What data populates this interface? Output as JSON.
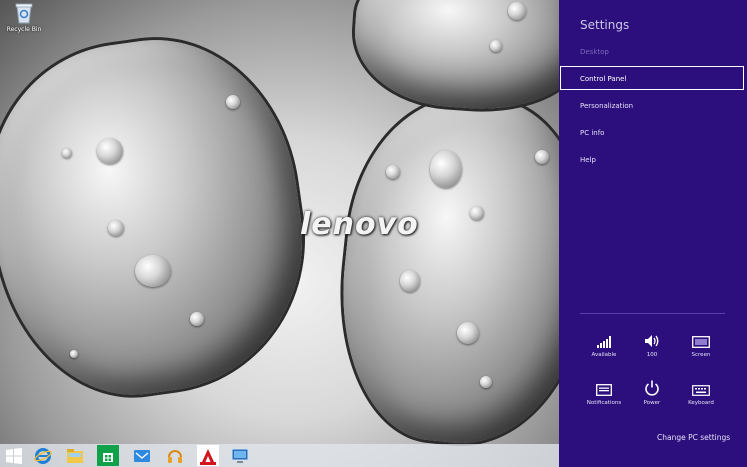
{
  "desktop": {
    "recycle_bin_label": "Recycle Bin",
    "brand_logo": "lenovo"
  },
  "taskbar": {
    "icons": [
      "start-icon",
      "internet-explorer-icon",
      "file-explorer-icon",
      "store-icon",
      "mail-icon",
      "media-icon",
      "adobe-icon",
      "remote-desktop-icon"
    ]
  },
  "settings_charm": {
    "title": "Settings",
    "items": [
      {
        "label": "Desktop",
        "state": "disabled"
      },
      {
        "label": "Control Panel",
        "state": "selected"
      },
      {
        "label": "Personalization",
        "state": "normal"
      },
      {
        "label": "PC info",
        "state": "normal"
      },
      {
        "label": "Help",
        "state": "normal"
      }
    ],
    "quick_tiles": [
      {
        "label": "Available",
        "icon": "network-signal-icon"
      },
      {
        "label": "100",
        "icon": "volume-icon"
      },
      {
        "label": "Screen",
        "icon": "screen-icon"
      },
      {
        "label": "Notifications",
        "icon": "notifications-icon"
      },
      {
        "label": "Power",
        "icon": "power-icon"
      },
      {
        "label": "Keyboard",
        "icon": "keyboard-icon"
      }
    ],
    "change_pc_settings": "Change PC settings"
  },
  "colors": {
    "charm_background": "#2c0f7c",
    "charm_text": "#e6e0f7",
    "disabled_text": "#7b68b9",
    "taskbar": "#e1e6eb"
  }
}
